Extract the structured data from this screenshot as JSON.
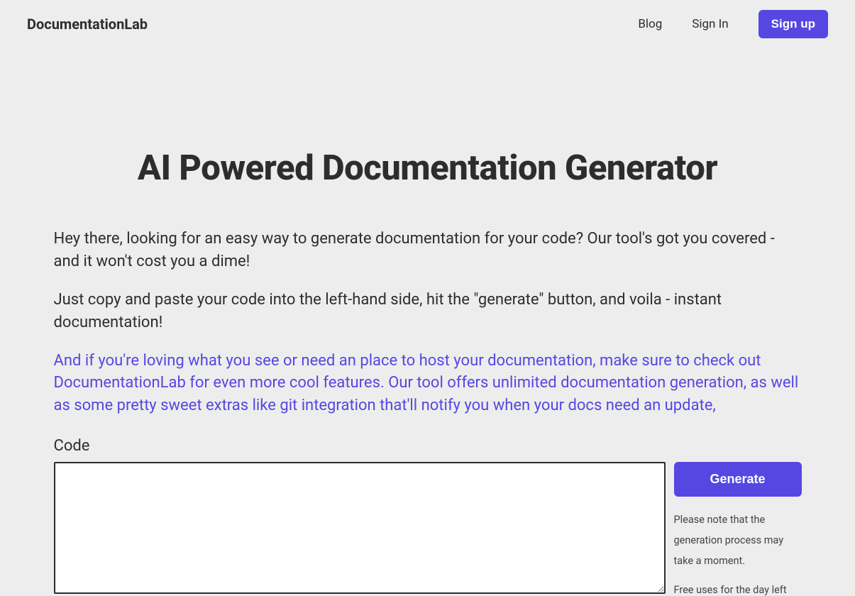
{
  "header": {
    "logo": "DocumentationLab",
    "nav": {
      "blog": "Blog",
      "signin": "Sign In",
      "signup": "Sign up"
    }
  },
  "main": {
    "title": "AI Powered Documentation Generator",
    "intro_p1": "Hey there, looking for an easy way to generate documentation for your code? Our tool's got you covered - and it won't cost you a dime!",
    "intro_p2": "Just copy and paste your code into the left-hand side, hit the \"generate\" button, and voila - instant documentation!",
    "promo_prefix": "And if you're loving what you see or need an place to host your documentation, make sure to check out ",
    "promo_link": "DocumentationLab",
    "promo_suffix": " for even more cool features. Our tool offers unlimited documentation generation, as well as some pretty sweet extras like git integration that'll notify you when your docs need an update,",
    "code_label": "Code",
    "code_value": "",
    "generate_label": "Generate",
    "note": "Please note that the generation process may take a moment.",
    "uses_left": "Free uses for the day left"
  }
}
